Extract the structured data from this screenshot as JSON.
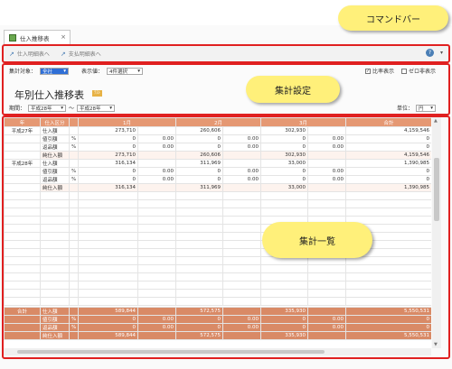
{
  "tab": {
    "label": "仕入推移表",
    "close": "×"
  },
  "commandbar": {
    "items": [
      "仕入明細表へ",
      "支払明細表へ"
    ],
    "callout": "コマンドバー"
  },
  "settings": {
    "target_label": "集計対象：",
    "target_value": "全社",
    "display_label": "表示値：",
    "display_value": "4件選択",
    "ratio_label": "比率表示",
    "zero_label": "ゼロ非表示",
    "title": "年別仕入推移表",
    "badge": "ﾃｽﾄ",
    "period_label": "期間：",
    "period_from": "平成28年",
    "period_sep": "～",
    "period_to": "平成28年",
    "unit_label": "単位：",
    "unit_value": "円",
    "callout": "集計設定"
  },
  "table": {
    "headers": [
      "年",
      "仕入区分",
      "",
      "1月",
      "",
      "2月",
      "",
      "3月",
      "",
      "合計"
    ],
    "rows": [
      {
        "year": "平成27年",
        "label": "仕入額",
        "pct": "",
        "v1": "273,710",
        "p1": "",
        "v2": "260,606",
        "p2": "",
        "v3": "302,930",
        "p3": "",
        "vt": "4,159,546"
      },
      {
        "year": "",
        "label": "値引額",
        "pct": "%",
        "v1": "0",
        "p1": "0.00",
        "v2": "0",
        "p2": "0.00",
        "v3": "0",
        "p3": "0.00",
        "vt": "0"
      },
      {
        "year": "",
        "label": "返品額",
        "pct": "%",
        "v1": "0",
        "p1": "0.00",
        "v2": "0",
        "p2": "0.00",
        "v3": "0",
        "p3": "0.00",
        "vt": "0"
      },
      {
        "year": "",
        "label": "純仕入額",
        "pct": "",
        "v1": "273,710",
        "p1": "",
        "v2": "260,606",
        "p2": "",
        "v3": "302,930",
        "p3": "",
        "vt": "4,159,546"
      },
      {
        "year": "平成28年",
        "label": "仕入額",
        "pct": "",
        "v1": "316,134",
        "p1": "",
        "v2": "311,969",
        "p2": "",
        "v3": "33,000",
        "p3": "",
        "vt": "1,390,985"
      },
      {
        "year": "",
        "label": "値引額",
        "pct": "%",
        "v1": "0",
        "p1": "0.00",
        "v2": "0",
        "p2": "0.00",
        "v3": "0",
        "p3": "0.00",
        "vt": "0"
      },
      {
        "year": "",
        "label": "返品額",
        "pct": "%",
        "v1": "0",
        "p1": "0.00",
        "v2": "0",
        "p2": "0.00",
        "v3": "0",
        "p3": "0.00",
        "vt": "0"
      },
      {
        "year": "",
        "label": "純仕入額",
        "pct": "",
        "v1": "316,134",
        "p1": "",
        "v2": "311,969",
        "p2": "",
        "v3": "33,000",
        "p3": "",
        "vt": "1,390,985"
      }
    ],
    "totals": [
      {
        "year": "合計",
        "label": "仕入額",
        "pct": "",
        "v1": "589,844",
        "p1": "",
        "v2": "572,575",
        "p2": "",
        "v3": "335,930",
        "p3": "",
        "vt": "5,550,531"
      },
      {
        "year": "",
        "label": "値引額",
        "pct": "%",
        "v1": "0",
        "p1": "0.00",
        "v2": "0",
        "p2": "0.00",
        "v3": "0",
        "p3": "0.00",
        "vt": "0"
      },
      {
        "year": "",
        "label": "返品額",
        "pct": "%",
        "v1": "0",
        "p1": "0.00",
        "v2": "0",
        "p2": "0.00",
        "v3": "0",
        "p3": "0.00",
        "vt": "0"
      },
      {
        "year": "",
        "label": "純仕入額",
        "pct": "",
        "v1": "589,844",
        "p1": "",
        "v2": "572,575",
        "p2": "",
        "v3": "335,930",
        "p3": "",
        "vt": "5,550,531"
      }
    ],
    "callout": "集計一覧"
  }
}
